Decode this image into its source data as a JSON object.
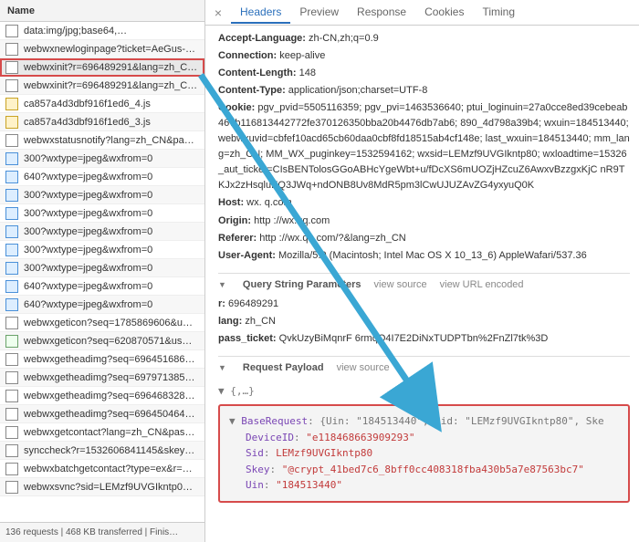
{
  "left": {
    "header": "Name",
    "footer": "136 requests | 468 KB transferred | Finis…",
    "items": [
      {
        "icon": "doc",
        "name": "data:img/jpg;base64,…"
      },
      {
        "icon": "doc",
        "name": "webwxnewloginpage?ticket=AeGus-…"
      },
      {
        "icon": "doc",
        "name": "webwxinit?r=696489291&lang=zh_C…",
        "selected": true
      },
      {
        "icon": "doc",
        "name": "webwxinit?r=696489291&lang=zh_C…"
      },
      {
        "icon": "js",
        "name": "ca857a4d3dbf916f1ed6_4.js"
      },
      {
        "icon": "js",
        "name": "ca857a4d3dbf916f1ed6_3.js"
      },
      {
        "icon": "doc",
        "name": "webwxstatusnotify?lang=zh_CN&pa…"
      },
      {
        "icon": "img",
        "name": "300?wxtype=jpeg&wxfrom=0"
      },
      {
        "icon": "img",
        "name": "640?wxtype=jpeg&wxfrom=0"
      },
      {
        "icon": "img",
        "name": "300?wxtype=jpeg&wxfrom=0"
      },
      {
        "icon": "img",
        "name": "300?wxtype=jpeg&wxfrom=0"
      },
      {
        "icon": "img",
        "name": "300?wxtype=jpeg&wxfrom=0"
      },
      {
        "icon": "img",
        "name": "300?wxtype=jpeg&wxfrom=0"
      },
      {
        "icon": "img",
        "name": "300?wxtype=jpeg&wxfrom=0"
      },
      {
        "icon": "img",
        "name": "640?wxtype=jpeg&wxfrom=0"
      },
      {
        "icon": "img",
        "name": "640?wxtype=jpeg&wxfrom=0"
      },
      {
        "icon": "doc",
        "name": "webwxgeticon?seq=1785869606&u…"
      },
      {
        "icon": "other",
        "name": "webwxgeticon?seq=620870571&us…"
      },
      {
        "icon": "doc",
        "name": "webwxgetheadimg?seq=696451686…"
      },
      {
        "icon": "doc",
        "name": "webwxgetheadimg?seq=697971385…"
      },
      {
        "icon": "doc",
        "name": "webwxgetheadimg?seq=696468328…"
      },
      {
        "icon": "doc",
        "name": "webwxgetheadimg?seq=696450464…"
      },
      {
        "icon": "doc",
        "name": "webwxgetcontact?lang=zh_CN&pas…"
      },
      {
        "icon": "doc",
        "name": "synccheck?r=1532606841145&skey…"
      },
      {
        "icon": "doc",
        "name": "webwxbatchgetcontact?type=ex&r=…"
      },
      {
        "icon": "doc",
        "name": "webwxsvnc?sid=LEMzf9UVGIkntp0…"
      }
    ]
  },
  "tabs": {
    "items": [
      "Headers",
      "Preview",
      "Response",
      "Cookies",
      "Timing"
    ],
    "active": 0
  },
  "headers_section": {
    "pairs": [
      {
        "k": "Accept-Language",
        "v": "zh-CN,zh;q=0.9"
      },
      {
        "k": "Connection",
        "v": "keep-alive"
      },
      {
        "k": "Content-Length",
        "v": "148"
      },
      {
        "k": "Content-Type",
        "v": "application/json;charset=UTF-8"
      },
      {
        "k": "Cookie",
        "v": "pgv_pvid=5505116359; pgv_pvi=1463536640; ptui_loginuin=27a0cce8ed39cebeab467b116813442772fe370126350bba20b4476db7ab6; 890_4d798a39b4; wxuin=184513440; webwxuvid=cbfef10acd65cb60daa0cbf8fd18515ab4cf148e; last_wxuin=184513440; mm_lang=zh_CN; MM_WX_puginkey=1532594162; wxsid=LEMzf9UVGIkntp80; wxloadtime=15326_aut_ticket=CIsBENTolosGGoABHcYgeWbt+u/fDcXS6mUOZjHZcuZ6AwxvBzzgxKjC nR9TKJx2zHsqluEQ3JWq+ndONB8Uv8MdR5pm3lCwUJUZAvZG4yxyuQ0K"
      },
      {
        "k": "Host",
        "v": "wx. q.com"
      },
      {
        "k": "Origin",
        "v": "http ://wx.qq.com"
      },
      {
        "k": "Referer",
        "v": "http ://wx.qq.com/?&lang=zh_CN"
      },
      {
        "k": "User-Agent",
        "v": "Mozilla/5.0 (Macintosh; Intel Mac OS X 10_13_6) AppleWafari/537.36"
      }
    ]
  },
  "query_section": {
    "title": "Query String Parameters",
    "link_source": "view source",
    "link_encoded": "view URL encoded",
    "pairs": [
      {
        "k": "r",
        "v": "696489291"
      },
      {
        "k": "lang",
        "v": "zh_CN"
      },
      {
        "k": "pass_ticket",
        "v": "QvkUzyBiMqnrF  6rmqQ4I7E2DiNxTUDPTbn%2FnZl7tk%3D"
      }
    ]
  },
  "payload_section": {
    "title": "Request Payload",
    "link_source": "view source",
    "root_open": "{,…}",
    "base_request_label": "BaseRequest",
    "base_request_preview": "{Uin: \"184513440\", Sid: \"LEMzf9UVGIkntp80\", Ske",
    "fields": [
      {
        "k": "DeviceID",
        "v": "\"e118468663909293\""
      },
      {
        "k": "Sid",
        "v": "LEMzf9UVGIkntp80"
      },
      {
        "k": "Skey",
        "v": "\"@crypt_41bed7c6_8bff0cc408318fba430b5a7e87563bc7\""
      },
      {
        "k": "Uin",
        "v": "\"184513440\""
      }
    ]
  }
}
